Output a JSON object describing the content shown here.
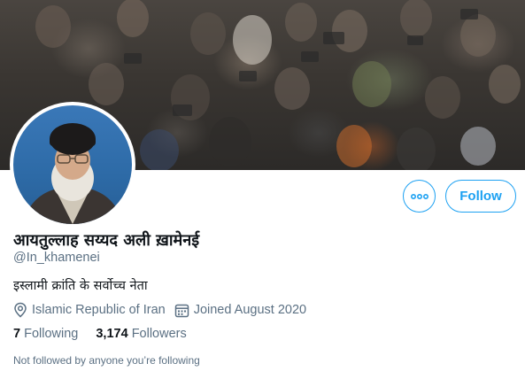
{
  "profile": {
    "display_name": "आयतुल्लाह सय्यद अली ख़ामेनई",
    "handle": "@In_khamenei",
    "bio": "इस्लामी क्रांति के सर्वोच्च नेता",
    "location": "Islamic Republic of Iran",
    "joined": "Joined August 2020",
    "following_count": "7",
    "following_label": "Following",
    "followers_count": "3,174",
    "followers_label": "Followers",
    "not_followed_text": "Not followed by anyone you’re following"
  },
  "actions": {
    "follow_label": "Follow",
    "more_icon": "more-icon"
  },
  "icons": {
    "location": "location-pin-icon",
    "calendar": "calendar-icon"
  },
  "colors": {
    "accent": "#1da1f2",
    "text_primary": "#0f1419",
    "text_secondary": "#5b7083"
  }
}
